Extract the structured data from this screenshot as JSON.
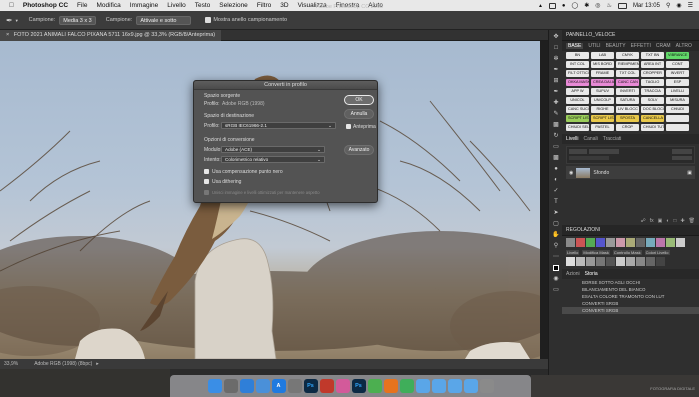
{
  "menubar": {
    "app": "Photoshop CC",
    "items": [
      "File",
      "Modifica",
      "Immagine",
      "Livello",
      "Testo",
      "Selezione",
      "Filtro",
      "3D",
      "Visualizza",
      "Finestra",
      "Aiuto"
    ],
    "clock": "Mar 13:05"
  },
  "options_bar": {
    "sample_label": "Campione:",
    "sample_value": "Media 3 x 3",
    "sample2_label": "Campione:",
    "sample2_value": "Attivale e sotto",
    "ring_label": "Mostra anello campionamento",
    "window_title": "Adobe Photoshop CC 2018"
  },
  "document": {
    "tab_title": "FOTO 2021 ANIMALI FALCO PIXANA 5711 16x9.jpg @ 33,3% (RGB/8/Anteprima)",
    "zoom": "33,9%",
    "profile_status": "Adobe RGB (1998) (8bpc)"
  },
  "dialog": {
    "title": "Converti in profilo",
    "source_section": "Spazio sorgente",
    "source_profile_label": "Profilo:",
    "source_profile_value": "Adobe RGB (1998)",
    "dest_section": "Spazio di destinazione",
    "dest_profile_label": "Profilo:",
    "dest_profile_value": "sRGB IEC61966-2.1",
    "options_section": "Opzioni di conversione",
    "engine_label": "Modulo:",
    "engine_value": "Adobe (ACE)",
    "intent_label": "Intento:",
    "intent_value": "Colorimetrico relativo",
    "bpc_label": "Usa compensazione punto nero",
    "dither_label": "Usa dithering",
    "flatten_label": "Unisci immagine e livelli ottimizzati per mantenere aspetto",
    "ok_label": "OK",
    "cancel_label": "Annulla",
    "preview_label": "Anteprima",
    "advanced_label": "Avanzato"
  },
  "panel": {
    "title": "PANNELLO_VELOCE",
    "tabs": [
      "BASE",
      "UTILI",
      "BEAUTY",
      "EFFETTI",
      "CRAM",
      "ALTRO"
    ],
    "buttons": [
      {
        "label": "BN",
        "color": "#e8e8e8"
      },
      {
        "label": "LAB",
        "color": "#e8e8e8"
      },
      {
        "label": "CMYK",
        "color": "#e8e8e8"
      },
      {
        "label": "TXT BN",
        "color": "#e8e8e8"
      },
      {
        "label": "VIBRANCE",
        "color": "#62d96a"
      },
      {
        "label": "INT COL",
        "color": "#e8e8e8"
      },
      {
        "label": "MIS BORD",
        "color": "#e8e8e8"
      },
      {
        "label": "RIEMPIMENTO",
        "color": "#e8e8e8"
      },
      {
        "label": "AREA INT",
        "color": "#e8e8e8"
      },
      {
        "label": "CONT",
        "color": "#e8e8e8"
      },
      {
        "label": "FILT OTTICO",
        "color": "#e8e8e8"
      },
      {
        "label": "FRAME",
        "color": "#e8e8e8"
      },
      {
        "label": "TXT COL",
        "color": "#e8e8e8"
      },
      {
        "label": "CROPPER",
        "color": "#e8e8e8"
      },
      {
        "label": "INVERT",
        "color": "#e8e8e8"
      },
      {
        "label": "OKKA MASK",
        "color": "#e88ad6"
      },
      {
        "label": "CREA DAI ALT",
        "color": "#e88ad6"
      },
      {
        "label": "CANC CAN",
        "color": "#e88ad6"
      },
      {
        "label": "TAGLIO",
        "color": "#e8e8e8"
      },
      {
        "label": "ESP",
        "color": "#e8e8e8"
      },
      {
        "label": "APP W",
        "color": "#e8e8e8"
      },
      {
        "label": "SUPUV",
        "color": "#e8e8e8"
      },
      {
        "label": "INVERTI",
        "color": "#e8e8e8"
      },
      {
        "label": "TRACCIA",
        "color": "#e8e8e8"
      },
      {
        "label": "LIVELLI",
        "color": "#e8e8e8"
      },
      {
        "label": "UNICOL",
        "color": "#e8e8e8"
      },
      {
        "label": "UNICOLP",
        "color": "#e8e8e8"
      },
      {
        "label": "SATURA",
        "color": "#e8e8e8"
      },
      {
        "label": "SOLV",
        "color": "#e8e8e8"
      },
      {
        "label": "MISURA",
        "color": "#e8e8e8"
      },
      {
        "label": "CANC SUCC",
        "color": "#e8e8e8"
      },
      {
        "label": "RIGHE",
        "color": "#e8e8e8"
      },
      {
        "label": "LIV BLOCC",
        "color": "#e8e8e8"
      },
      {
        "label": "DOC BLOCC",
        "color": "#e8e8e8"
      },
      {
        "label": "CHIUDI",
        "color": "#e8e8e8"
      },
      {
        "label": "SCRIPT LIST",
        "color": "#9acd5a"
      },
      {
        "label": "SCRIPT LIST ATT",
        "color": "#e8c84a"
      },
      {
        "label": "SPOSTA",
        "color": "#e8c84a"
      },
      {
        "label": "CANCELLA",
        "color": "#e8c84a"
      },
      {
        "label": "",
        "color": "#e8e8e8"
      },
      {
        "label": "CHIUDI SELEZ",
        "color": "#e8e8e8"
      },
      {
        "label": "PASTEL",
        "color": "#e8e8e8"
      },
      {
        "label": "CROP",
        "color": "#e8e8e8"
      },
      {
        "label": "CHIUDI TUTTO",
        "color": "#e8e8e8"
      },
      {
        "label": "",
        "color": "#e8e8e8"
      }
    ]
  },
  "layers": {
    "tabs": [
      "Livelli",
      "Canali",
      "Tracciati"
    ],
    "layer_name": "Sfondo",
    "adjust_title": "REGOLAZIONI",
    "adj_tabs": [
      "Livello",
      "Modifica Mask",
      "Controllo Mask",
      "Colori Livello"
    ]
  },
  "history": {
    "tabs": [
      "Azioni",
      "Storia"
    ],
    "items": [
      "BORSE SOTTO AGLI OCCHI",
      "BILANCIAMENTO DEL BIANCO",
      "ESALTA COLORE TRAMONTO CON LUT",
      "CONVERTI SRGB",
      "CONVERTI SRGB"
    ]
  },
  "dock_apps": [
    {
      "name": "finder-icon",
      "label": "",
      "color": "#3a8ee6"
    },
    {
      "name": "launchpad-icon",
      "label": "",
      "color": "#6b6b6b"
    },
    {
      "name": "safari-icon",
      "label": "",
      "color": "#2f7fd8"
    },
    {
      "name": "mail-icon",
      "label": "",
      "color": "#4a90d9"
    },
    {
      "name": "appstore-icon",
      "label": "A",
      "color": "#1f7ae0"
    },
    {
      "name": "preferences-icon",
      "label": "",
      "color": "#777777"
    },
    {
      "name": "photoshop-icon",
      "label": "Ps",
      "color": "#0c2a44"
    },
    {
      "name": "app-red-icon",
      "label": "",
      "color": "#c0392b"
    },
    {
      "name": "app-pink-icon",
      "label": "",
      "color": "#d35a9a"
    },
    {
      "name": "photoshop2-icon",
      "label": "Ps",
      "color": "#0c2a44"
    },
    {
      "name": "chrome-icon",
      "label": "",
      "color": "#4caf50"
    },
    {
      "name": "app-orange-icon",
      "label": "",
      "color": "#e6731e"
    },
    {
      "name": "app-green-icon",
      "label": "",
      "color": "#3fae5a"
    },
    {
      "name": "folder1-icon",
      "label": "",
      "color": "#5aa6e8"
    },
    {
      "name": "folder2-icon",
      "label": "",
      "color": "#5aa6e8"
    },
    {
      "name": "folder3-icon",
      "label": "",
      "color": "#5aa6e8"
    },
    {
      "name": "folder4-icon",
      "label": "",
      "color": "#5aa6e8"
    },
    {
      "name": "trash-icon",
      "label": "",
      "color": "#8a8a8a"
    }
  ],
  "watermark": "FOTOGRAFIA DIGITALE"
}
